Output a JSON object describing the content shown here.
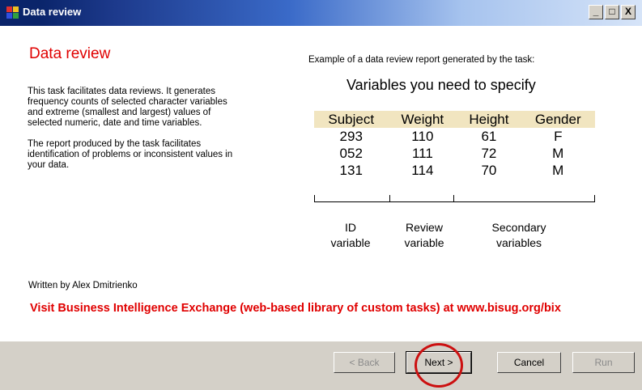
{
  "window": {
    "title": "Data review",
    "minimize_label": "_",
    "maximize_label": "□",
    "close_label": "X"
  },
  "main": {
    "heading": "Data review",
    "paragraph_1": [
      "This task facilitates data reviews. It generates",
      "frequency counts of selected character variables",
      "and extreme (smallest and largest) values of",
      "selected numeric, date and time variables."
    ],
    "paragraph_2": [
      "The report produced by the task facilitates",
      "identification of problems or inconsistent values in",
      "your data."
    ],
    "author": "Written by Alex Dmitrienko",
    "visit_link": "Visit Business Intelligence Exchange (web-based library of custom tasks) at www.bisug.org/bix"
  },
  "example": {
    "caption": "Example of a data review report generated by the task:",
    "title": "Variables you need to specify",
    "columns": [
      "Subject",
      "Weight",
      "Height",
      "Gender"
    ],
    "rows": [
      [
        "293",
        "110",
        "61",
        "F"
      ],
      [
        "052",
        "111",
        "72",
        "M"
      ],
      [
        "131",
        "114",
        "70",
        "M"
      ]
    ],
    "roles": [
      {
        "line1": "ID",
        "line2": "variable"
      },
      {
        "line1": "Review",
        "line2": "variable"
      },
      {
        "line1": "Secondary",
        "line2": "variables"
      }
    ]
  },
  "buttons": {
    "back": "< Back",
    "next": "Next >",
    "cancel": "Cancel",
    "run": "Run"
  },
  "colors": {
    "heading_red": "#e00000",
    "header_row": "#f1e5c0",
    "annotation_circle": "#cc1010"
  }
}
